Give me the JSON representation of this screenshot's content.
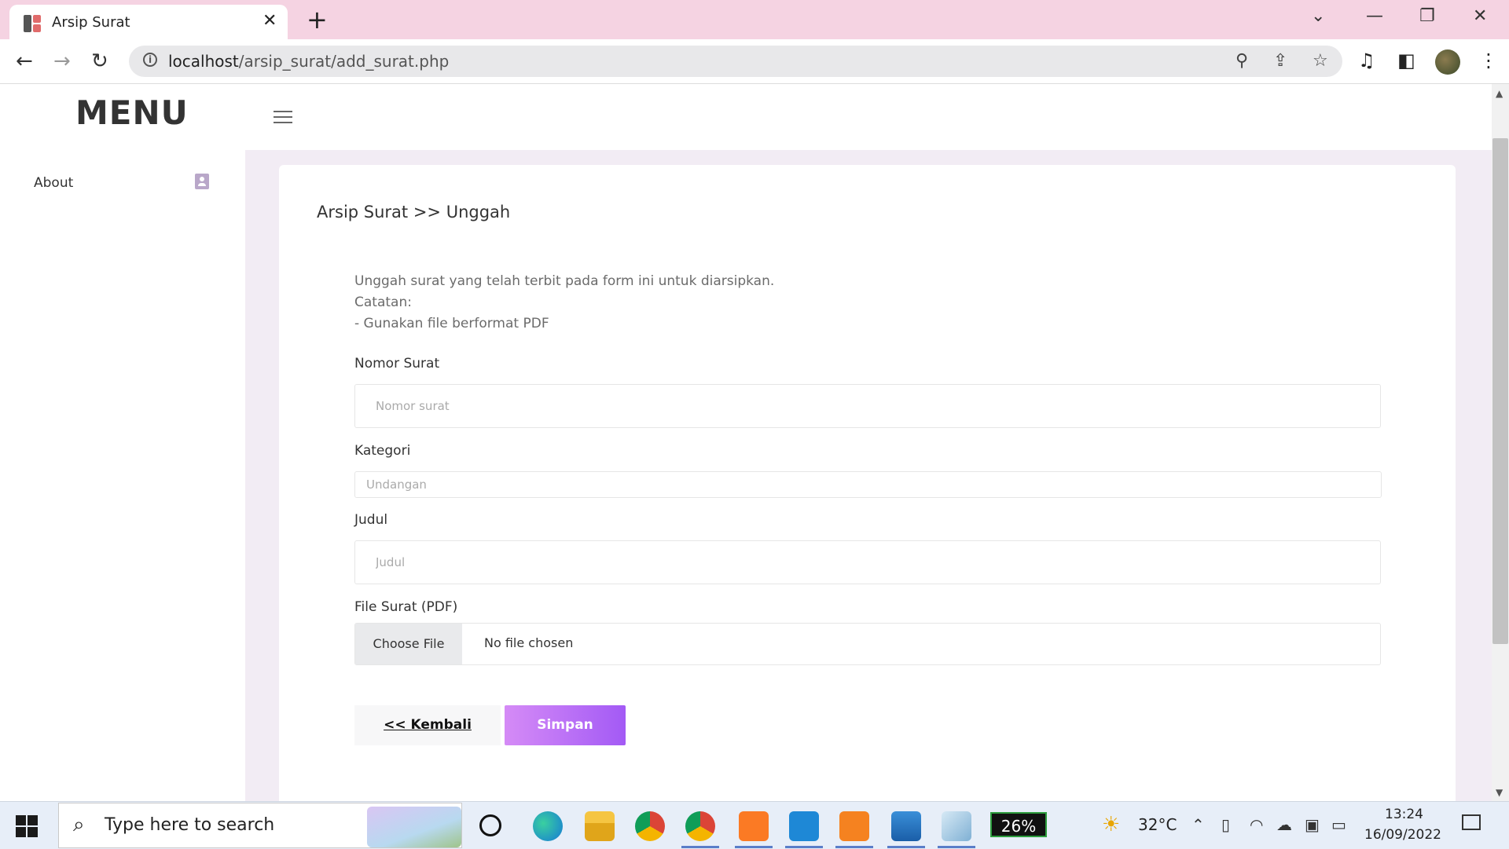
{
  "browser": {
    "tab_title": "Arsip Surat",
    "url_host": "localhost",
    "url_path": "/arsip_surat/add_surat.php"
  },
  "sidebar": {
    "heading": "MENU",
    "items": [
      {
        "label": "About",
        "icon": "contact-card-icon"
      }
    ]
  },
  "main": {
    "breadcrumb": "Arsip Surat >> Unggah",
    "intro": [
      "Unggah surat yang telah terbit pada form ini untuk diarsipkan.",
      "Catatan:",
      "- Gunakan file berformat PDF"
    ],
    "fields": {
      "nomor_label": "Nomor Surat",
      "nomor_placeholder": "Nomor surat",
      "kategori_label": "Kategori",
      "kategori_value": "Undangan",
      "judul_label": "Judul",
      "judul_placeholder": "Judul",
      "file_label": "File Surat (PDF)",
      "file_button": "Choose File",
      "file_status": "No file chosen"
    },
    "buttons": {
      "back": "<< Kembali",
      "save": "Simpan"
    },
    "colors": {
      "save_gradient_start": "#d58bf6",
      "save_gradient_end": "#a35af5",
      "page_bg": "#f2ecf4"
    }
  },
  "taskbar": {
    "search_placeholder": "Type here to search",
    "battery": "26%",
    "temperature": "32°C",
    "time": "13:24",
    "date": "16/09/2022"
  }
}
